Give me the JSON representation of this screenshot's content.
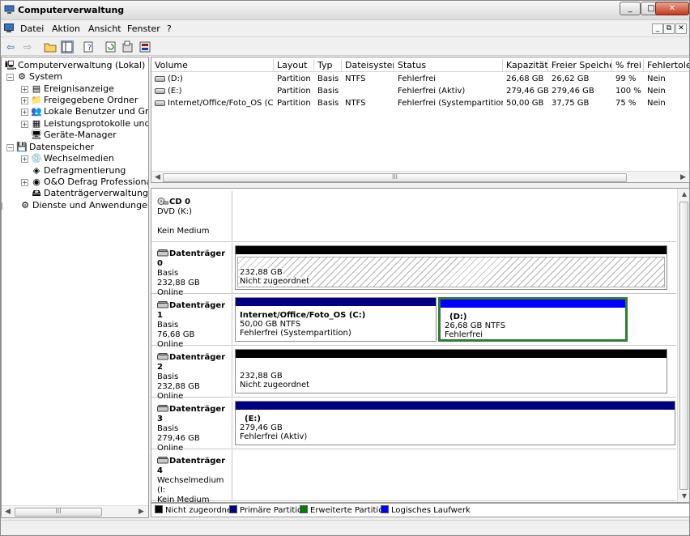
{
  "window": {
    "title": "Computerverwaltung",
    "min": "_",
    "max": "□",
    "close": "✕"
  },
  "menu": [
    "Datei",
    "Aktion",
    "Ansicht",
    "Fenster",
    "?"
  ],
  "mdi": {
    "min": "_",
    "restore": "⧉",
    "close": "✕"
  },
  "tree": [
    {
      "label": "Computerverwaltung (Lokal)",
      "expander": "",
      "icon": "computer-icon",
      "glyph": "🖳"
    },
    {
      "label": "System",
      "expander": "−",
      "icon": "system-tools-icon",
      "glyph": "⚙"
    },
    {
      "label": "Ereignisanzeige",
      "expander": "+",
      "icon": "event-viewer-icon",
      "glyph": "▤"
    },
    {
      "label": "Freigegebene Ordner",
      "expander": "+",
      "icon": "shared-folder-icon",
      "glyph": "📁"
    },
    {
      "label": "Lokale Benutzer und Grupp",
      "expander": "+",
      "icon": "users-icon",
      "glyph": "👥"
    },
    {
      "label": "Leistungsprotokolle und W",
      "expander": "+",
      "icon": "performance-icon",
      "glyph": "▦"
    },
    {
      "label": "Geräte-Manager",
      "expander": "",
      "icon": "device-manager-icon",
      "glyph": "🖥"
    },
    {
      "label": "Datenspeicher",
      "expander": "−",
      "icon": "storage-icon",
      "glyph": "💾"
    },
    {
      "label": "Wechselmedien",
      "expander": "+",
      "icon": "removable-media-icon",
      "glyph": "💿"
    },
    {
      "label": "Defragmentierung",
      "expander": "",
      "icon": "defrag-icon",
      "glyph": "◈"
    },
    {
      "label": "O&O Defrag Professional E",
      "expander": "+",
      "icon": "oo-defrag-icon",
      "glyph": "◉"
    },
    {
      "label": "Datenträgerverwaltung",
      "expander": "",
      "icon": "disk-management-icon",
      "glyph": "🖴"
    },
    {
      "label": "Dienste und Anwendungen",
      "expander": "+",
      "icon": "services-icon",
      "glyph": "⚙"
    }
  ],
  "columns": [
    "Volume",
    "Layout",
    "Typ",
    "Dateisystem",
    "Status",
    "Kapazität",
    "Freier Speicher",
    "% frei",
    "Fehlertolera"
  ],
  "volumes": [
    [
      "(D:)",
      "Partition",
      "Basis",
      "NTFS",
      "Fehlerfrei",
      "26,68 GB",
      "26,62 GB",
      "99 %",
      "Nein"
    ],
    [
      "(E:)",
      "Partition",
      "Basis",
      "",
      "Fehlerfrei (Aktiv)",
      "279,46 GB",
      "279,46 GB",
      "100 %",
      "Nein"
    ],
    [
      "Internet/Office/Foto_OS (C:)",
      "Partition",
      "Basis",
      "NTFS",
      "Fehlerfrei (Systempartition)",
      "50,00 GB",
      "37,75 GB",
      "75 %",
      "Nein"
    ]
  ],
  "scroll_thumb": "III",
  "disks": [
    {
      "name": "CD 0",
      "lines": [
        "DVD (K:)",
        "",
        "Kein Medium"
      ]
    },
    {
      "name": "Datenträger 0",
      "lines": [
        "Basis",
        "232,88 GB",
        "Online"
      ],
      "parts": [
        {
          "l1": "",
          "l2": "232,88 GB",
          "l3": "Nicht zugeordnet"
        }
      ]
    },
    {
      "name": "Datenträger 1",
      "lines": [
        "Basis",
        "76,68 GB",
        "Online"
      ],
      "parts": [
        {
          "l1": "Internet/Office/Foto_OS  (C:)",
          "l2": "50,00 GB NTFS",
          "l3": "Fehlerfrei (Systempartition)"
        },
        {
          "l1": "(D:)",
          "l2": "26,68 GB NTFS",
          "l3": "Fehlerfrei"
        }
      ]
    },
    {
      "name": "Datenträger 2",
      "lines": [
        "Basis",
        "232,88 GB",
        "Online"
      ],
      "parts": [
        {
          "l1": "",
          "l2": "232,88 GB",
          "l3": "Nicht zugeordnet"
        }
      ]
    },
    {
      "name": "Datenträger 3",
      "lines": [
        "Basis",
        "279,46 GB",
        "Online"
      ],
      "parts": [
        {
          "l1": "(E:)",
          "l2": "279,46 GB",
          "l3": "Fehlerfrei (Aktiv)"
        }
      ]
    },
    {
      "name": "Datenträger 4",
      "lines": [
        "Wechselmedium (I:",
        "",
        "Kein Medium"
      ]
    }
  ],
  "legend": [
    {
      "label": "Nicht zugeordnet",
      "color": "#000000"
    },
    {
      "label": "Primäre Partition",
      "color": "#000080"
    },
    {
      "label": "Erweiterte Partition",
      "color": "#008000"
    },
    {
      "label": "Logisches Laufwerk",
      "color": "#0000ff"
    }
  ],
  "colors": {
    "unallocated": "#000000",
    "primary": "#000080",
    "extended": "#008000",
    "logical": "#0000ff",
    "selected_border": "#2e7d32"
  }
}
